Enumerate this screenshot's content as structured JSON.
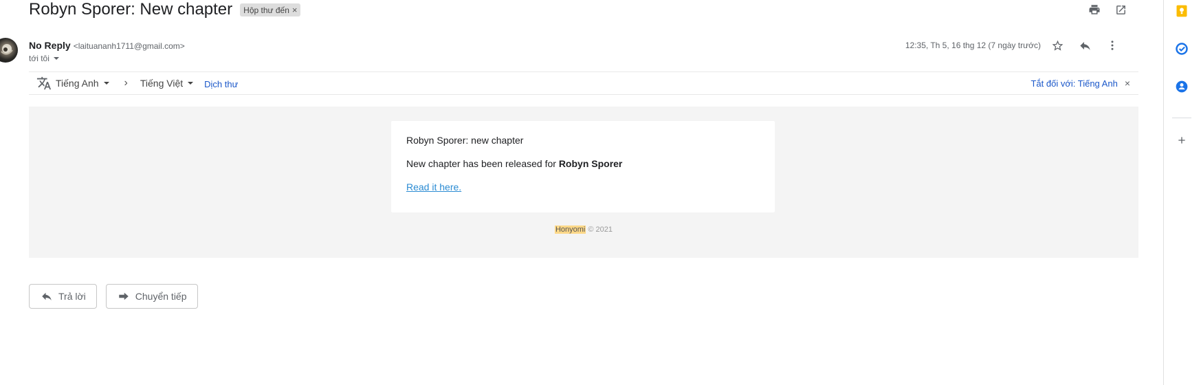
{
  "email": {
    "subject": "Robyn Sporer: New chapter",
    "label": "Hộp thư đến",
    "sender_name": "No Reply",
    "sender_email": "<laituananh1711@gmail.com>",
    "to": "tới tôi",
    "date": "12:35, Th 5, 16 thg 12 (7 ngày trước)"
  },
  "translate": {
    "from_lang": "Tiếng Anh",
    "to_lang": "Tiếng Việt",
    "translate_link": "Dịch thư",
    "turn_off": "Tắt đối với: Tiếng Anh"
  },
  "body": {
    "line1": "Robyn Sporer: new chapter",
    "line2_prefix": "New chapter has been released for ",
    "line2_bold": "Robyn Sporer",
    "link": "Read it here.",
    "footer_brand": "Honyomi",
    "footer_rest": " © 2021"
  },
  "actions": {
    "reply": "Trả lời",
    "forward": "Chuyển tiếp"
  },
  "colors": {
    "link_blue": "#1a57c9",
    "body_link": "#2a8bd3",
    "keep_yellow": "#fbbc04",
    "tasks_blue": "#1a73e8",
    "contacts_blue": "#1a73e8",
    "footer_highlight": "#fdd888"
  },
  "icons": {
    "top": [
      "print-icon",
      "open-in-new-window-icon"
    ],
    "meta": [
      "star-icon",
      "reply-icon",
      "more-vert-icon"
    ],
    "side": [
      "keep-icon",
      "tasks-icon",
      "contacts-icon",
      "add-icon"
    ]
  }
}
